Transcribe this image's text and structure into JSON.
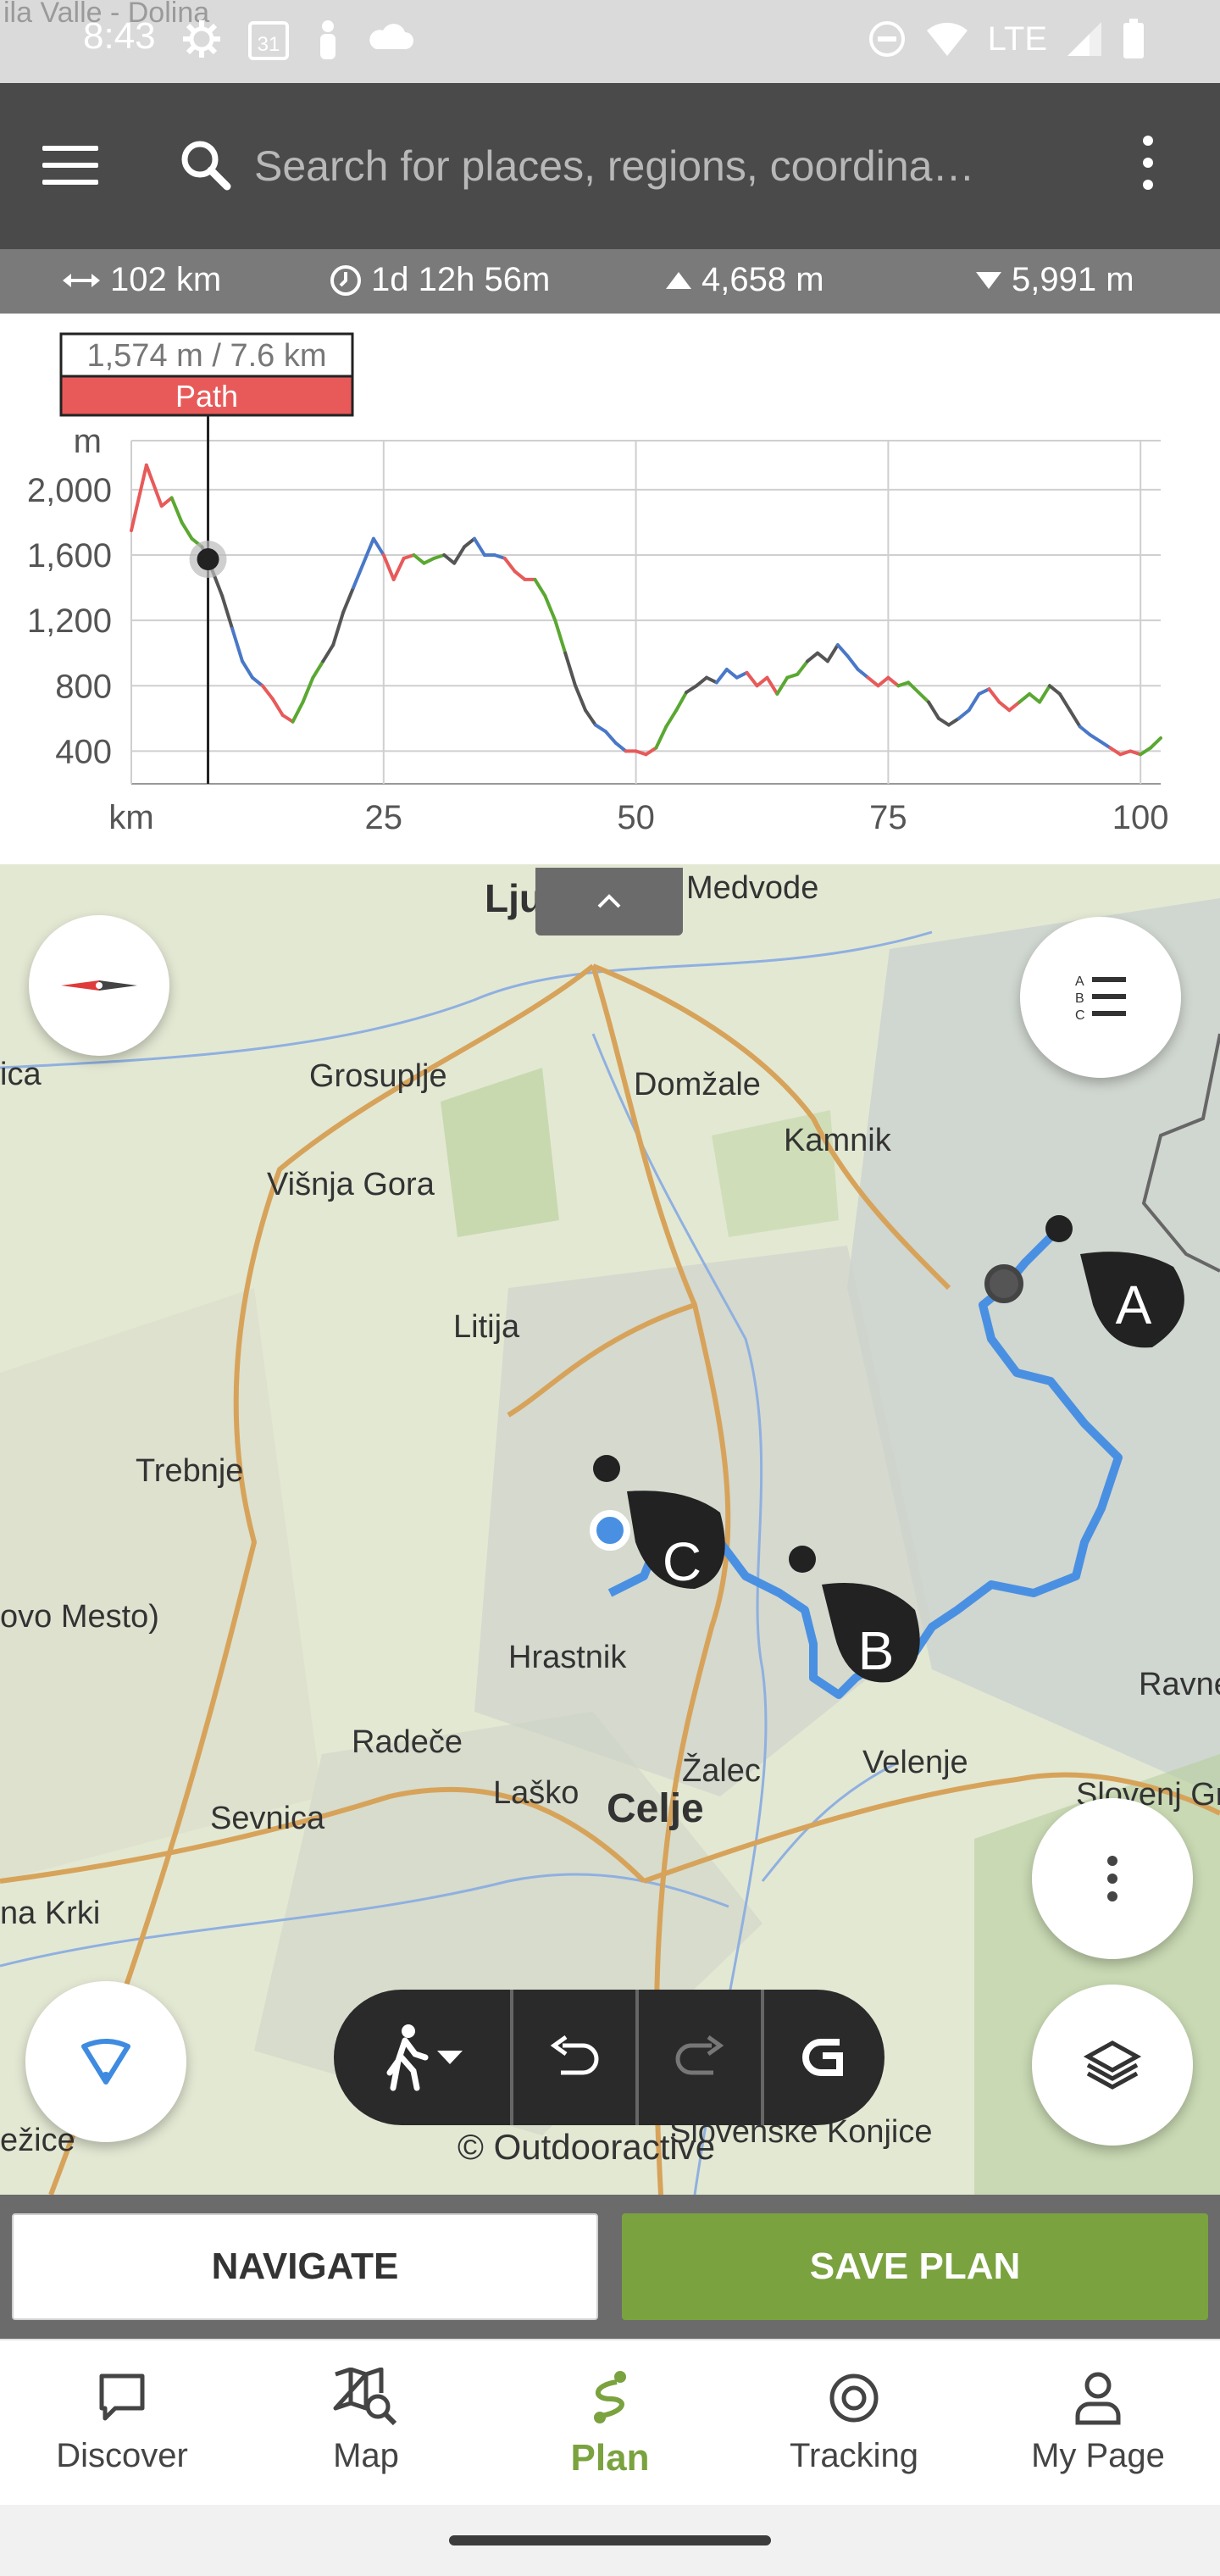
{
  "status_bar": {
    "time": "8:43",
    "network": "LTE",
    "background_text": "ila Valle - Dolina",
    "icons": [
      "gear-icon",
      "calendar-icon",
      "person-icon",
      "cloud-icon",
      "do-not-disturb-icon",
      "wifi-icon",
      "signal-icon",
      "battery-icon"
    ],
    "calendar_day": "31"
  },
  "search": {
    "placeholder": "Search for places, regions, coordina…"
  },
  "stats": {
    "distance": "102 km",
    "duration": "1d 12h 56m",
    "ascent": "4,658 m",
    "descent": "5,991 m"
  },
  "profile": {
    "tooltip_value": "1,574 m / 7.6 km",
    "tooltip_label": "Path",
    "tooltip_color": "#e85a5a",
    "y_unit": "m",
    "x_unit": "km",
    "y_ticks": [
      "2,000",
      "1,600",
      "1,200",
      "800",
      "400"
    ],
    "x_ticks": [
      "25",
      "50",
      "75",
      "100"
    ]
  },
  "chart_data": {
    "type": "area",
    "xlabel": "km",
    "ylabel": "m",
    "xlim": [
      0,
      102
    ],
    "ylim": [
      200,
      2300
    ],
    "x": [
      0,
      1.5,
      3,
      4,
      5,
      6,
      7,
      7.6,
      9,
      10,
      11,
      12,
      13,
      14,
      15,
      16,
      17,
      18,
      19,
      20,
      21,
      22,
      23,
      24,
      25,
      26,
      27,
      28,
      29,
      30,
      31,
      32,
      33,
      34,
      35,
      36,
      37,
      38,
      39,
      40,
      41,
      42,
      43,
      44,
      45,
      46,
      47,
      48,
      49,
      50,
      51,
      52,
      53,
      54,
      55,
      56,
      57,
      58,
      59,
      60,
      61,
      62,
      63,
      64,
      65,
      66,
      67,
      68,
      69,
      70,
      71,
      72,
      73,
      74,
      75,
      76,
      77,
      78,
      79,
      80,
      81,
      82,
      83,
      84,
      85,
      86,
      87,
      88,
      89,
      90,
      91,
      92,
      93,
      94,
      95,
      96,
      97,
      98,
      99,
      100,
      101,
      102
    ],
    "y": [
      1750,
      2150,
      1900,
      1950,
      1800,
      1700,
      1650,
      1574,
      1350,
      1150,
      950,
      850,
      800,
      720,
      620,
      580,
      700,
      850,
      950,
      1050,
      1250,
      1400,
      1550,
      1700,
      1600,
      1450,
      1580,
      1600,
      1550,
      1580,
      1600,
      1550,
      1650,
      1700,
      1600,
      1600,
      1580,
      1500,
      1450,
      1450,
      1350,
      1200,
      1000,
      800,
      650,
      560,
      520,
      450,
      400,
      400,
      380,
      420,
      550,
      650,
      760,
      800,
      850,
      820,
      900,
      850,
      880,
      800,
      850,
      750,
      850,
      870,
      950,
      1000,
      950,
      1050,
      980,
      900,
      850,
      800,
      850,
      800,
      820,
      760,
      700,
      600,
      560,
      600,
      650,
      750,
      780,
      700,
      650,
      700,
      750,
      700,
      800,
      750,
      650,
      550,
      500,
      460,
      420,
      380,
      400,
      380,
      420,
      480
    ],
    "series_colors": [
      "#e85a5a",
      "#5aa832",
      "#555555",
      "#4a78c8"
    ]
  },
  "map": {
    "labels": [
      "Medvode",
      "Ljubljana",
      "Grosuplje",
      "Domžale",
      "Kamnik",
      "Višnja Gora",
      "Litija",
      "Trebnje",
      "ovo Mesto)",
      "Hrastnik",
      "Radeče",
      "Laško",
      "Celje",
      "Žalec",
      "Velenje",
      "Sevnica",
      "na Krki",
      "Ravne",
      "Slovenj Gra",
      "Slovenske Konjice",
      "ežice",
      "ica"
    ],
    "waypoints": [
      "A",
      "B",
      "C"
    ],
    "route_color": "#4a90e2",
    "copyright": "© Outdooractive"
  },
  "actions": {
    "navigate": "NAVIGATE",
    "save_plan": "SAVE PLAN",
    "save_color": "#7aa23e"
  },
  "nav": {
    "items": [
      {
        "label": "Discover",
        "icon": "chat-bubble-icon"
      },
      {
        "label": "Map",
        "icon": "map-search-icon"
      },
      {
        "label": "Plan",
        "icon": "route-plan-icon"
      },
      {
        "label": "Tracking",
        "icon": "target-icon"
      },
      {
        "label": "My Page",
        "icon": "person-outline-icon"
      }
    ],
    "active_color": "#7aa23e"
  }
}
